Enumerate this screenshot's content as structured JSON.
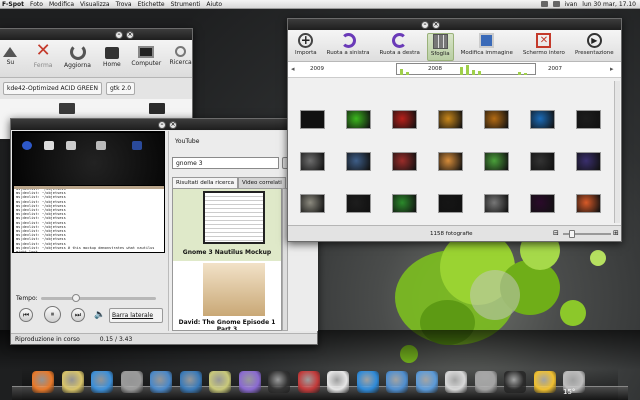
{
  "top_panel": {
    "menu": [
      "F-Spot",
      "Foto",
      "Modifica",
      "Visualizza",
      "Trova",
      "Etichette",
      "Strumenti",
      "Aiuto"
    ],
    "user": "ivan",
    "clock": "lun 30 mar, 17.10"
  },
  "file_manager": {
    "toolbar": [
      {
        "label": "Su",
        "icon": "up-arrow-icon"
      },
      {
        "label": "Ferma",
        "icon": "stop-icon"
      },
      {
        "label": "Aggiorna",
        "icon": "reload-icon"
      },
      {
        "label": "Home",
        "icon": "home-icon"
      },
      {
        "label": "Computer",
        "icon": "computer-icon"
      },
      {
        "label": "Ricerca",
        "icon": "search-icon"
      }
    ],
    "tags": [
      "kde42-Optimized ACID GREEN",
      "gtk 2.0"
    ]
  },
  "video_player": {
    "terminal_lines": [
      "ms|devlist: ~/objetsess",
      "ms|devlist: ~/objetsess",
      "ms|devlist: ~/objetsess",
      "ms|devlist: ~/objetsess",
      "ms|devlist: ~/objetsess",
      "ms|devlist: ~/objetsess",
      "ms|devlist: ~/objetsess",
      "ms|devlist: ~/objetsess",
      "ms|devlist: ~/objetsess",
      "ms|devlist: ~/objetsess",
      "ms|devlist: ~/objetsess",
      "ms|devlist: ~/objetsess",
      "ms|devlist: ~/objetsess",
      "ms|devlist: ~/objetsess",
      "ms|devlist: ~/objetsess # this mockup demonstrates what nautilus might look"
    ],
    "seek_label": "Tempo:",
    "seek_fraction": 0.3,
    "sidebar_toggle": "Barra laterale",
    "status_text": "Riproduzione in corso",
    "status_time": "0.15 / 3.43",
    "youtube": {
      "title": "YouTube",
      "search_value": "gnome 3",
      "tabs": [
        "Risultati della ricerca",
        "Video correlati"
      ],
      "results": [
        "Gnome 3 Nautilus Mockup",
        "David: The Gnome Episode 1 Part 3"
      ]
    }
  },
  "photo_manager": {
    "toolbar": [
      {
        "label": "Importa",
        "icon": "import-plus-icon"
      },
      {
        "label": "Ruota a sinistra",
        "icon": "rotate-left-icon"
      },
      {
        "label": "Ruota a destra",
        "icon": "rotate-right-icon"
      },
      {
        "label": "Sfoglia",
        "icon": "browse-icon"
      },
      {
        "label": "Modifica immagine",
        "icon": "edit-image-icon"
      },
      {
        "label": "Schermo intero",
        "icon": "fullscreen-icon"
      },
      {
        "label": "Presentazione",
        "icon": "slideshow-play-icon"
      }
    ],
    "timeline": [
      "2009",
      "2008",
      "2007"
    ],
    "status": "1158 fotografie",
    "zoom_fraction": 0.18,
    "thumb_colors": [
      [
        "#111111",
        "#3cb81e",
        "#b8201a",
        "#c9871a",
        "#b46b12",
        "#1b6bb8",
        "#1c1c1c"
      ],
      [
        "#6d6d6d",
        "#3e5e88",
        "#9b2d2a",
        "#d68c3a",
        "#4aa03a",
        "#333333",
        "#3a2f6e"
      ],
      [
        "#8c8a7f",
        "#1d1d1d",
        "#2b8a2b",
        "#151515",
        "#777777",
        "#2a0a2a",
        "#d85a28"
      ]
    ]
  },
  "dock": {
    "items": [
      {
        "icon": "firefox-icon",
        "color": "#e8792a"
      },
      {
        "icon": "mail-icon",
        "color": "#d8c46a"
      },
      {
        "icon": "chat-icon",
        "color": "#3c8fd8"
      },
      {
        "icon": "printer-icon",
        "color": "#9a9a9a"
      },
      {
        "icon": "photos-icon",
        "color": "#4a88c8"
      },
      {
        "icon": "image-viewer-icon",
        "color": "#3a7ab8"
      },
      {
        "icon": "disc-icon",
        "color": "#c9c97a"
      },
      {
        "icon": "music-icon",
        "color": "#8a6ad0"
      },
      {
        "icon": "video-icon",
        "color": "#333333"
      },
      {
        "icon": "movie-icon",
        "color": "#c23a3a"
      },
      {
        "icon": "cd-icon",
        "color": "#e6e6e6"
      },
      {
        "icon": "star-icon",
        "color": "#2f8ad8"
      },
      {
        "icon": "editor-icon",
        "color": "#4f8ecf"
      },
      {
        "icon": "pen-icon",
        "color": "#5b9ad8"
      },
      {
        "icon": "chart-icon",
        "color": "#d8d8d8"
      },
      {
        "icon": "drive-icon",
        "color": "#a3a3a3"
      },
      {
        "icon": "monitor-icon",
        "color": "#2b2b2b"
      },
      {
        "icon": "weather-icon",
        "color": "#f0c030"
      },
      {
        "icon": "trash-icon",
        "color": "#bdbdbd"
      }
    ],
    "temperature": "15°"
  }
}
